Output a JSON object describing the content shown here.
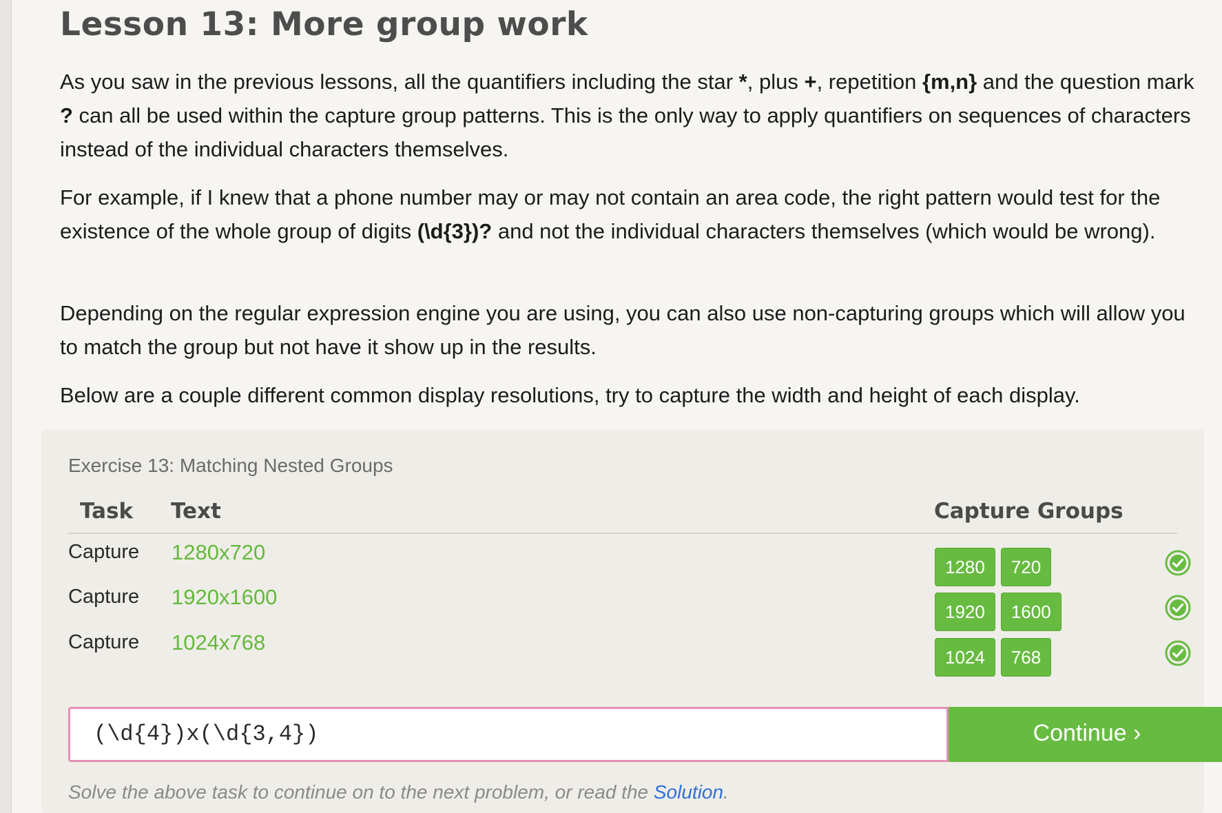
{
  "lesson": {
    "title": "Lesson 13: More group work",
    "paragraphs": {
      "p1": {
        "a": "As you saw in the previous lessons, all the quantifiers including the star ",
        "star": "*",
        "b": ", plus ",
        "plus": "+",
        "c": ", repetition ",
        "repetition": "{m,n}",
        "d": " and the question mark ",
        "question": "?",
        "e": " can all be used within the capture group patterns. This is the only way to apply quantifiers on sequences of characters instead of the individual characters themselves."
      },
      "p2": {
        "a": "For example, if I knew that a phone number may or may not contain an area code, the right pattern would test for the existence of the whole group of digits ",
        "code": "(\\d{3})?",
        "b": " and not the individual characters themselves (which would be wrong)."
      },
      "p3": "Depending on the regular expression engine you are using, you can also use non-capturing groups which will allow you to match the group but not have it show up in the results.",
      "p4": "Below are a couple different common display resolutions, try to capture the width and height of each display."
    }
  },
  "exercise": {
    "title": "Exercise 13: Matching Nested Groups",
    "columns": {
      "task": "Task",
      "text": "Text",
      "groups": "Capture Groups"
    },
    "rows": [
      {
        "task": "Capture",
        "text": "1280x720",
        "groups": [
          "1280",
          "720"
        ],
        "status": "success"
      },
      {
        "task": "Capture",
        "text": "1920x1600",
        "groups": [
          "1920",
          "1600"
        ],
        "status": "success"
      },
      {
        "task": "Capture",
        "text": "1024x768",
        "groups": [
          "1024",
          "768"
        ],
        "status": "success"
      }
    ],
    "input_value": "(\\d{4})x(\\d{3,4})",
    "continue_label": "Continue ›",
    "footer": {
      "before": "Solve the above task to continue on to the next problem, or read the ",
      "link": "Solution",
      "after": "."
    }
  },
  "colors": {
    "success": "#67bb40",
    "input_border": "#e68fb5",
    "link": "#2f6fd6"
  },
  "icons": {
    "row_status": "check-circle-icon"
  }
}
